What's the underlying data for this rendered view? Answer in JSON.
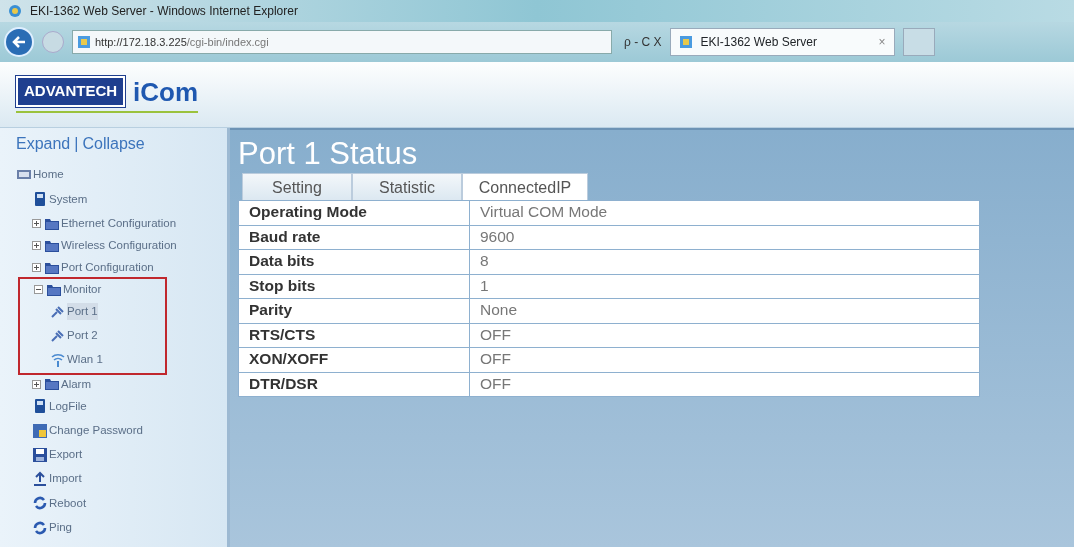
{
  "window": {
    "title": "EKI-1362 Web Server - Windows Internet Explorer"
  },
  "browser": {
    "address": "http://172.18.3.225/cgi-bin/index.cgi",
    "address_controls": "ρ - C X",
    "tab": {
      "label": "EKI-1362 Web Server",
      "close": "×"
    }
  },
  "logo": {
    "brand": "ADVANTECH",
    "product": "iCom"
  },
  "sidebar": {
    "expand": "Expand",
    "separator": "|",
    "collapse": "Collapse",
    "tree": [
      {
        "label": "Home",
        "kind": "root",
        "selected": false,
        "children": [
          {
            "label": "System",
            "kind": "page",
            "selected": false
          },
          {
            "label": "Ethernet Configuration",
            "kind": "folder",
            "expanded": false,
            "selected": false
          },
          {
            "label": "Wireless Configuration",
            "kind": "folder",
            "expanded": false,
            "selected": false
          },
          {
            "label": "Port Configuration",
            "kind": "folder",
            "expanded": false,
            "selected": false
          },
          {
            "label": "Monitor",
            "kind": "folder",
            "expanded": true,
            "selected": false,
            "highlighted": true,
            "children": [
              {
                "label": "Port 1",
                "kind": "port",
                "selected": true
              },
              {
                "label": "Port 2",
                "kind": "port",
                "selected": false
              },
              {
                "label": "Wlan 1",
                "kind": "wifi",
                "selected": false
              }
            ]
          },
          {
            "label": "Alarm",
            "kind": "folder",
            "expanded": false,
            "selected": false
          },
          {
            "label": "LogFile",
            "kind": "page",
            "selected": false
          },
          {
            "label": "Change Password",
            "kind": "password",
            "selected": false
          },
          {
            "label": "Export",
            "kind": "save",
            "selected": false
          },
          {
            "label": "Import",
            "kind": "import",
            "selected": false
          },
          {
            "label": "Reboot",
            "kind": "cycle",
            "selected": false
          },
          {
            "label": "Ping",
            "kind": "cycle",
            "selected": false
          }
        ]
      }
    ]
  },
  "main": {
    "title": "Port 1 Status",
    "tabs": [
      {
        "label": "Setting",
        "selected": false
      },
      {
        "label": "Statistic",
        "selected": false
      },
      {
        "label": "ConnectedIP",
        "selected": true
      }
    ],
    "table": {
      "rows": [
        [
          "Operating Mode",
          "Virtual COM Mode"
        ],
        [
          "Baud rate",
          "9600"
        ],
        [
          "Data bits",
          "8"
        ],
        [
          "Stop bits",
          "1"
        ],
        [
          "Parity",
          "None"
        ],
        [
          "RTS/CTS",
          "OFF"
        ],
        [
          "XON/XOFF",
          "OFF"
        ],
        [
          "DTR/DSR",
          "OFF"
        ]
      ]
    }
  }
}
